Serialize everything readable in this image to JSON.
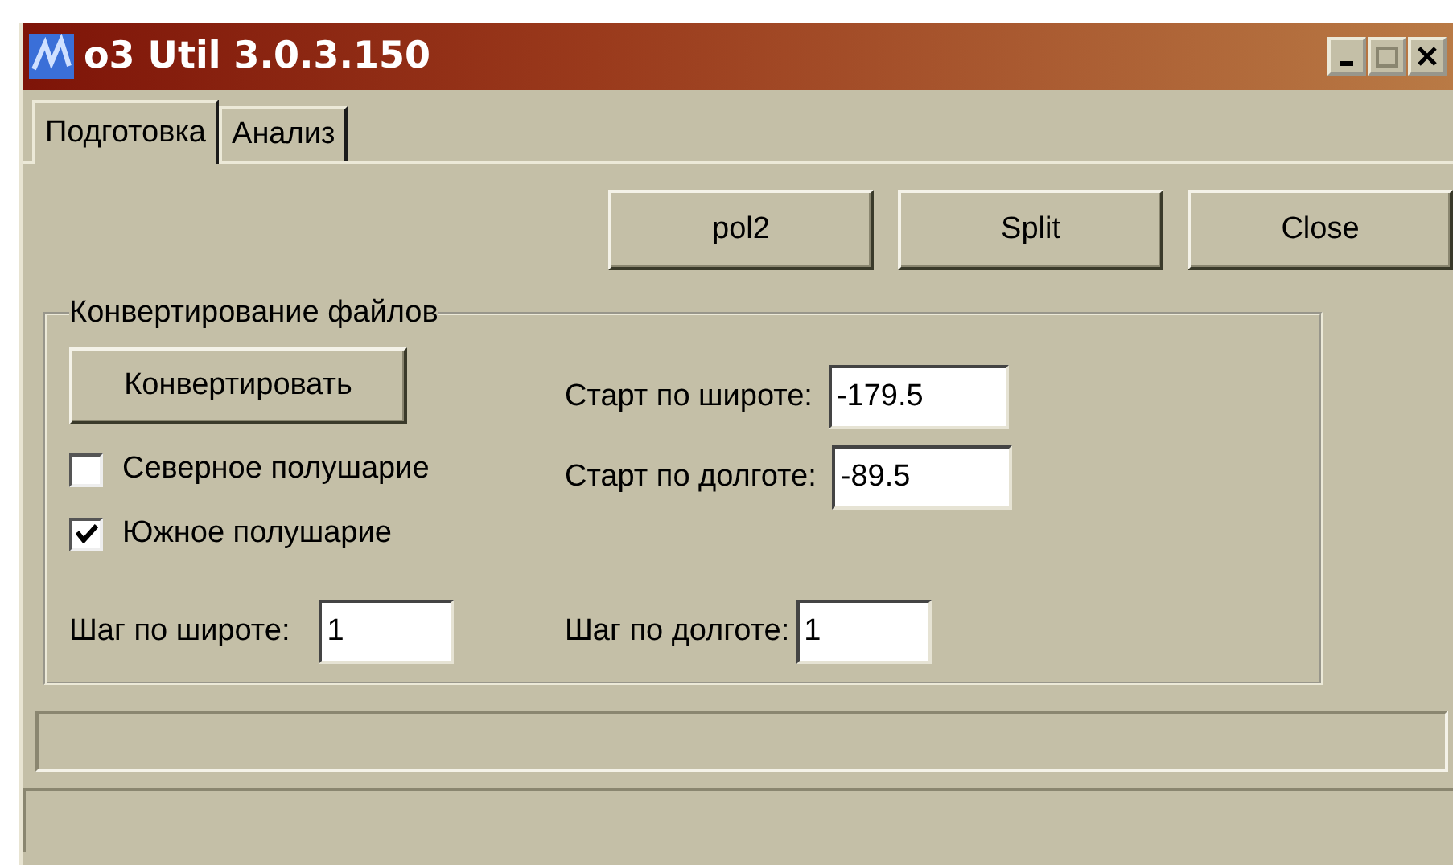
{
  "window": {
    "title": "o3 Util 3.0.3.150"
  },
  "tabs": [
    {
      "label": "Подготовка",
      "selected": true
    },
    {
      "label": "Анализ",
      "selected": false
    }
  ],
  "buttons": [
    "pol2",
    "Split",
    "Close"
  ],
  "group": {
    "title": "Конвертирование файлов",
    "convert_button": "Конвертировать",
    "checkboxes": [
      {
        "label": "Северное полушарие",
        "checked": false
      },
      {
        "label": "Южное полушарие",
        "checked": true
      }
    ],
    "start_fields": [
      {
        "label": "Старт по широте:",
        "value": "-179.5"
      },
      {
        "label": "Старт по долготе:",
        "value": "-89.5"
      }
    ],
    "step_fields": [
      {
        "label": "Шаг по широте:",
        "value": "1"
      },
      {
        "label": "Шаг по долготе:",
        "value": "1"
      }
    ]
  }
}
